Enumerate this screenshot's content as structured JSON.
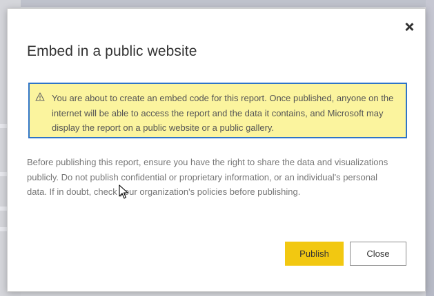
{
  "dialog": {
    "title": "Embed in a public website",
    "close_icon": "close-icon",
    "warning": {
      "icon": "warning-triangle-icon",
      "text": "You are about to create an embed code for this report. Once published, anyone on the internet will be able to access the report and the data it contains, and Microsoft may display the report on a public website or a public gallery."
    },
    "body": "Before publishing this report, ensure you have the right to share the data and visualizations publicly. Do not publish confidential or proprietary information, or an individual's personal data. If in doubt, check your organization's policies before publishing.",
    "buttons": {
      "publish_label": "Publish",
      "close_label": "Close"
    }
  },
  "colors": {
    "accent_yellow": "#f2c811",
    "warning_background": "#fbf49e",
    "warning_border": "#2e74c8"
  }
}
